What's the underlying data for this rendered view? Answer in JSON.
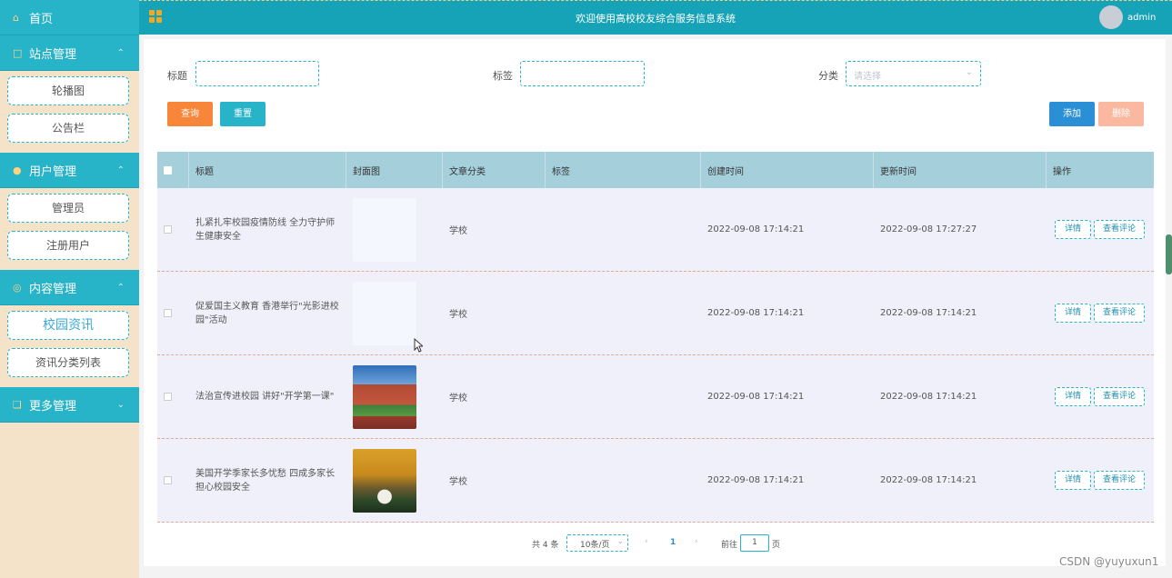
{
  "app": {
    "title": "欢迎使用高校校友综合服务信息系统",
    "user": "admin"
  },
  "sidebar": {
    "home": "首页",
    "groups": [
      {
        "label": "站点管理",
        "icon": "monitor-icon",
        "items": [
          "轮播图",
          "公告栏"
        ]
      },
      {
        "label": "用户管理",
        "icon": "user-icon",
        "items": [
          "管理员",
          "注册用户"
        ]
      },
      {
        "label": "内容管理",
        "icon": "content-icon",
        "items": [
          "校园资讯",
          "资讯分类列表"
        ],
        "active": "校园资讯"
      },
      {
        "label": "更多管理",
        "icon": "copy-icon",
        "items": []
      }
    ]
  },
  "filters": {
    "title_label": "标题",
    "title_value": "",
    "tag_label": "标签",
    "tag_value": "",
    "category_label": "分类",
    "category_placeholder": "请选择"
  },
  "actions": {
    "query": "查询",
    "reset": "重置",
    "add": "添加",
    "delete": "删除"
  },
  "table": {
    "columns": [
      "标题",
      "封面图",
      "文章分类",
      "标签",
      "创建时间",
      "更新时间",
      "操作"
    ],
    "rows": [
      {
        "title": "扎紧扎牢校园疫情防线 全力守护师生健康安全",
        "cover": "blank",
        "category": "学校",
        "tag": "",
        "created": "2022-09-08 17:14:21",
        "updated": "2022-09-08 17:27:27",
        "ops": [
          "详情",
          "查看评论"
        ]
      },
      {
        "title": "促爱国主义教育 香港举行\"光影进校园\"活动",
        "cover": "blank",
        "category": "学校",
        "tag": "",
        "created": "2022-09-08 17:14:21",
        "updated": "2022-09-08 17:14:21",
        "ops": [
          "详情",
          "查看评论"
        ]
      },
      {
        "title": "法治宣传进校园 讲好\"开学第一课\"",
        "cover": "campus-building-photo",
        "category": "学校",
        "tag": "",
        "created": "2022-09-08 17:14:21",
        "updated": "2022-09-08 17:14:21",
        "ops": [
          "详情",
          "查看评论"
        ]
      },
      {
        "title": "美国开学季家长多忧愁 四成多家长担心校园安全",
        "cover": "autumn-trees-photo",
        "category": "学校",
        "tag": "",
        "created": "2022-09-08 17:14:21",
        "updated": "2022-09-08 17:14:21",
        "ops": [
          "详情",
          "查看评论"
        ]
      }
    ]
  },
  "pagination": {
    "total": "共 4 条",
    "page_size": "10条/页",
    "current": "1",
    "goto_label": "前往",
    "goto_value": "1",
    "page_unit": "页"
  },
  "watermark": "CSDN @yuyuxun1",
  "colors": {
    "sidebar_header": "#27b3c8",
    "topbar": "#16a3b8",
    "table_header": "#a5cfdb",
    "query": "#f7863b",
    "reset": "#27b3c8",
    "add": "#2a8fd4",
    "delete": "#fbb8a0"
  }
}
